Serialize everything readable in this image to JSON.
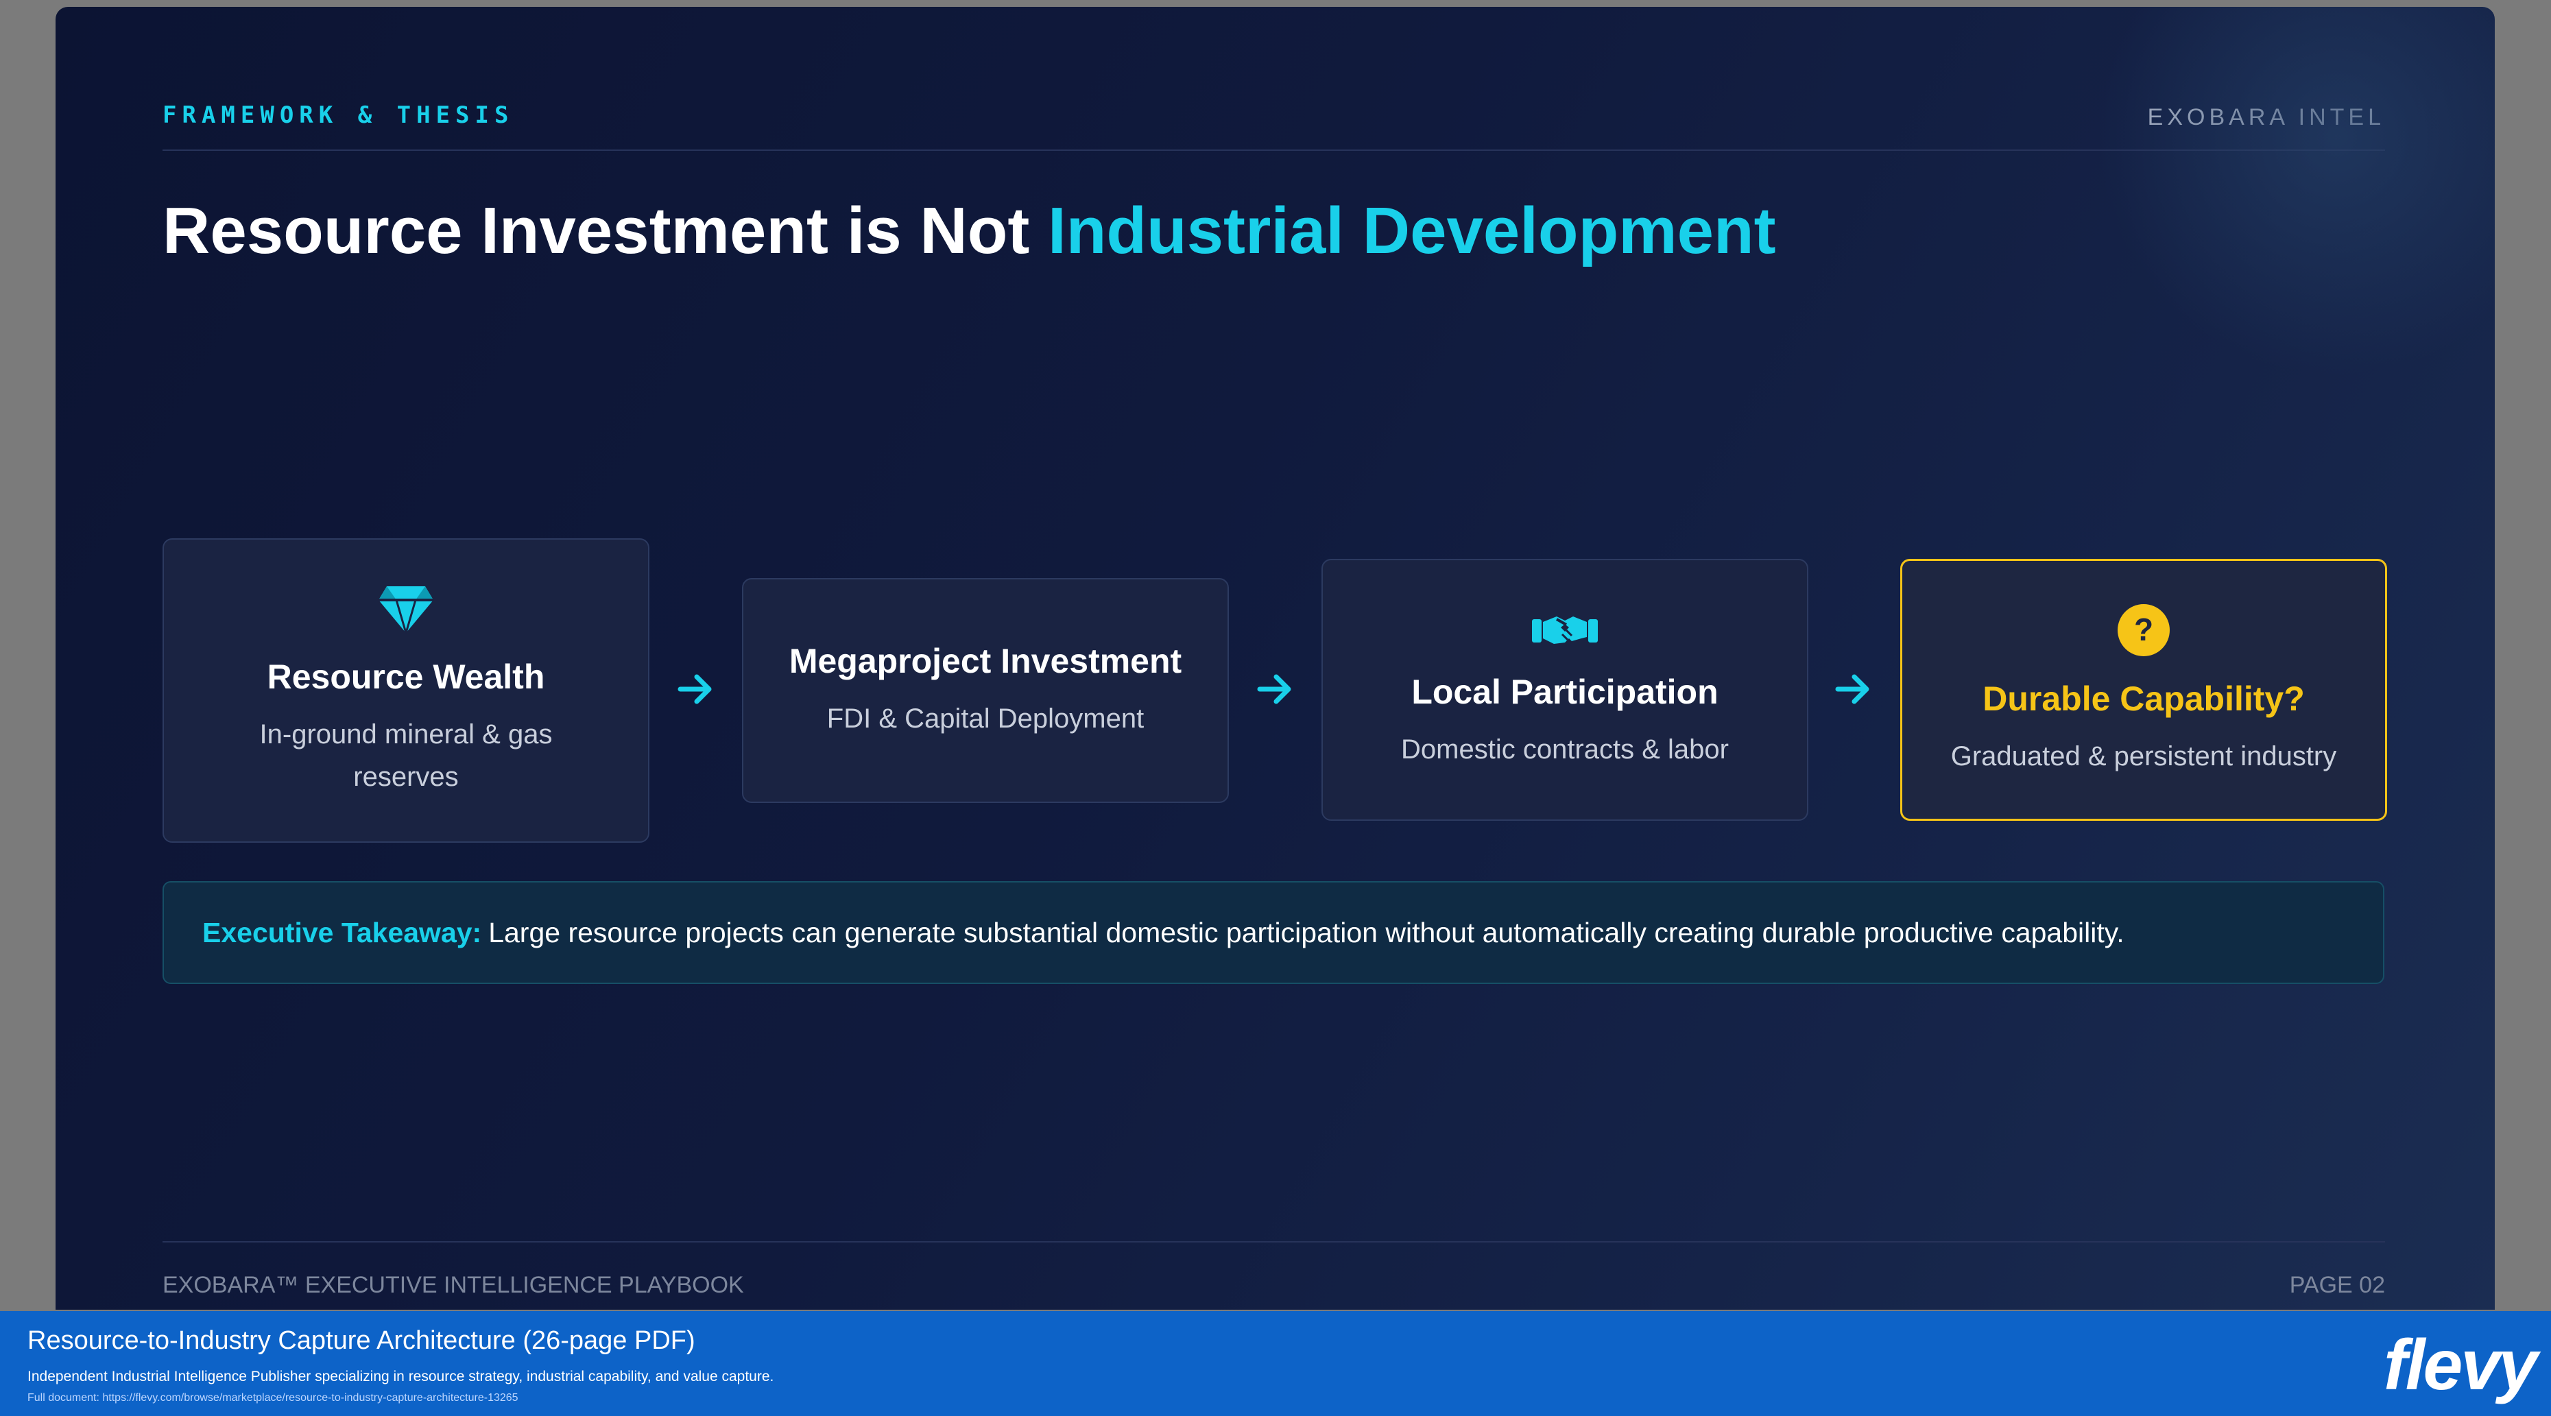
{
  "slide": {
    "kicker": "FRAMEWORK & THESIS",
    "brand": "EXOBARA INTEL",
    "title_main": "Resource Investment is Not ",
    "title_accent": "Industrial Development",
    "steps": [
      {
        "title": "Resource Wealth",
        "subtitle": "In-ground mineral & gas reserves",
        "icon": "diamond-icon"
      },
      {
        "title": "Megaproject Investment",
        "subtitle": "FDI & Capital Deployment"
      },
      {
        "title": "Local Participation",
        "subtitle": "Domestic contracts & labor",
        "icon": "handshake-icon"
      },
      {
        "title": "Durable Capability?",
        "subtitle": "Graduated & persistent industry",
        "icon": "question-icon"
      }
    ],
    "takeaway_label": "Executive Takeaway:",
    "takeaway_text": "Large resource projects can generate substantial domestic participation without automatically creating durable productive capability.",
    "footer_left": "EXOBARA™ EXECUTIVE INTELLIGENCE PLAYBOOK",
    "footer_right": "PAGE 02"
  },
  "banner": {
    "title": "Resource-to-Industry Capture Architecture",
    "pages": " (26-page PDF)",
    "description": "Independent Industrial Intelligence Publisher specializing in resource strategy, industrial capability, and value capture.",
    "link": "Full document: https://flevy.com/browse/marketplace/resource-to-industry-capture-architecture-13265",
    "logo": "flevy"
  },
  "colors": {
    "accent_cyan": "#19d0ea",
    "highlight_gold": "#f6c417",
    "banner_blue": "#0d63c8"
  }
}
